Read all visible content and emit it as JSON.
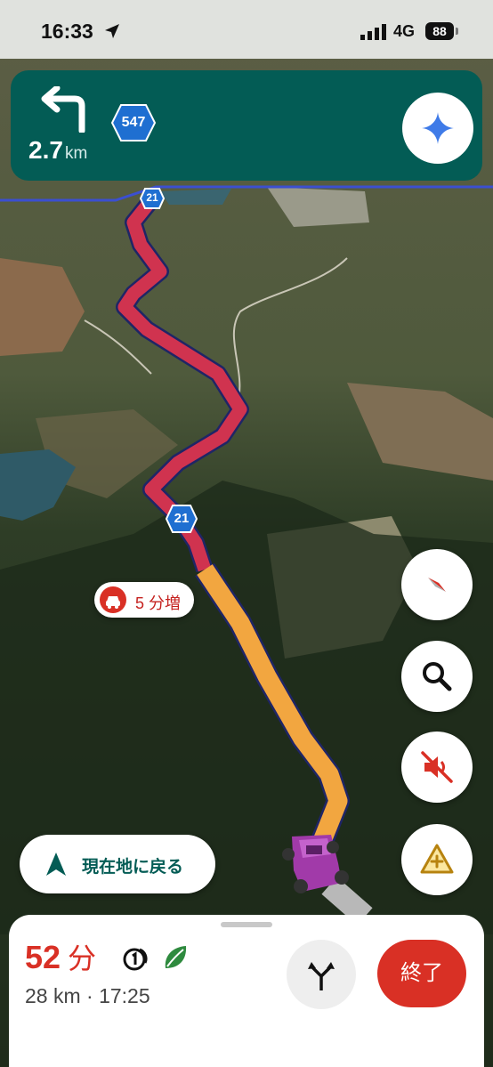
{
  "status_bar": {
    "time": "16:33",
    "network": "4G",
    "battery": "88"
  },
  "navigation": {
    "distance": "2.7",
    "distance_unit": "km",
    "next_road_shield": "547",
    "turn_direction": "turn-left-arrow-icon"
  },
  "map": {
    "route_shields": [
      "21",
      "21"
    ],
    "traffic_delay": "5 分増",
    "colors": {
      "route_heavy": "#d0334f",
      "route_moderate": "#f2a640",
      "route_outline": "#1f2566",
      "nav_card": "#035c55",
      "accent_red": "#d93025"
    }
  },
  "controls": {
    "compass": "compass-icon",
    "search": "search-icon",
    "mute": "volume-off-icon",
    "report": "report-incident-icon",
    "recenter_label": "現在地に戻る"
  },
  "trip": {
    "eta_minutes": "52",
    "eta_unit": "分",
    "detail": "28 km · 17:25",
    "end_label": "終了"
  }
}
